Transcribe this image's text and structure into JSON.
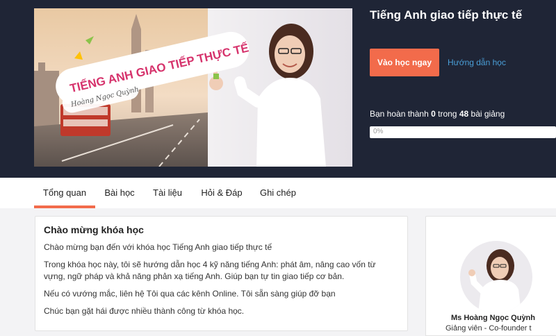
{
  "course": {
    "title": "Tiếng Anh giao tiếp thực tế",
    "banner_text": "TIẾNG ANH GIAO TIẾP THỰC TẾ",
    "banner_signature": "Hoàng Ngọc Quỳnh"
  },
  "actions": {
    "start_label": "Vào học ngay",
    "guide_label": "Hướng dẫn học"
  },
  "progress": {
    "prefix": "Bạn hoàn thành",
    "completed": "0",
    "middle": "trong",
    "total": "48",
    "suffix": "bài giảng",
    "percent_label": "0%",
    "fraction": 0
  },
  "tabs": [
    {
      "label": "Tổng quan",
      "active": true
    },
    {
      "label": "Bài học",
      "active": false
    },
    {
      "label": "Tài liệu",
      "active": false
    },
    {
      "label": "Hỏi & Đáp",
      "active": false
    },
    {
      "label": "Ghi chép",
      "active": false
    }
  ],
  "welcome": {
    "heading": "Chào mừng khóa học",
    "paragraphs": [
      "Chào mừng bạn đến với khóa học Tiếng Anh giao tiếp thực tế",
      "Trong khóa học này, tôi sẽ hướng dẫn học 4 kỹ năng tiếng Anh: phát âm, nâng cao vốn từ vựng, ngữ pháp và khả năng phản xạ tiếng Anh. Giúp bạn tự tin giao tiếp cơ bản.",
      "Nếu có vướng mắc, liên hệ Tôi qua các kênh Online. Tôi sẵn sàng giúp đỡ bạn",
      "Chúc bạn gặt hái được nhiều thành công từ khóa học."
    ]
  },
  "instructor": {
    "name": "Ms Hoàng Ngọc Quỳnh",
    "role": "Giảng viên - Co-founder t"
  },
  "colors": {
    "header_bg": "#1f2536",
    "accent": "#f26b4b",
    "link": "#4a9fd8"
  }
}
